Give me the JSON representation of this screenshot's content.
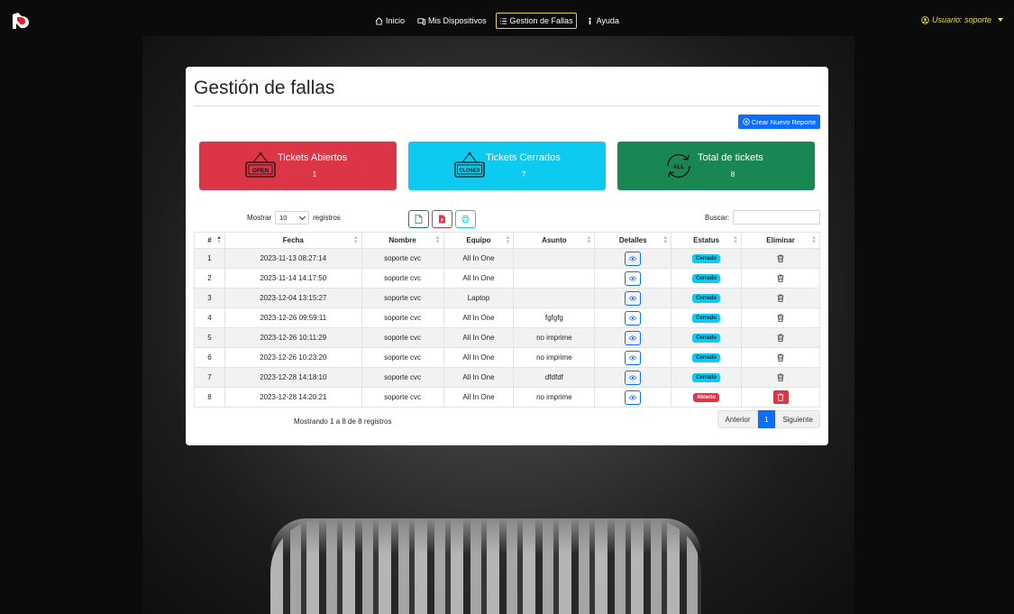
{
  "nav": {
    "links": [
      {
        "label": "Inicio",
        "icon": "home-icon"
      },
      {
        "label": "Mis Dispositivos",
        "icon": "devices-icon"
      },
      {
        "label": "Gestion de Fallas",
        "icon": "list-icon",
        "active": true
      },
      {
        "label": "Ayuda",
        "icon": "help-icon"
      }
    ],
    "user_label": "Usuario: soporte"
  },
  "page": {
    "title": "Gestión de fallas",
    "new_report_label": "Crear Nuevo Reporte"
  },
  "stats": [
    {
      "label": "Tickets Abiertos",
      "value": "1",
      "icon_text": "OPEN",
      "color": "#dc3545"
    },
    {
      "label": "Tickets Cerrados",
      "value": "7",
      "icon_text": "CLOSED",
      "color": "#0dcaf0"
    },
    {
      "label": "Total de tickets",
      "value": "8",
      "icon_text": "ALL",
      "color": "#198754"
    }
  ],
  "controls": {
    "show_label": "Mostrar",
    "show_value": "10",
    "records_label": "registros",
    "search_label": "Buscar:"
  },
  "table": {
    "headers": [
      "#",
      "Fecha",
      "Nombre",
      "Equipo",
      "Asunto",
      "Detalles",
      "Estatus",
      "Eliminar"
    ],
    "rows": [
      {
        "n": "1",
        "fecha": "2023-11-13 08:27:14",
        "nombre": "soporte cvc",
        "equipo": "All In One",
        "asunto": "",
        "estatus": "Cerrado"
      },
      {
        "n": "2",
        "fecha": "2023-11-14 14:17:50",
        "nombre": "soporte cvc",
        "equipo": "All In One",
        "asunto": "",
        "estatus": "Cerrado"
      },
      {
        "n": "3",
        "fecha": "2023-12-04 13:15:27",
        "nombre": "soporte cvc",
        "equipo": "Laptop",
        "asunto": "",
        "estatus": "Cerrado"
      },
      {
        "n": "4",
        "fecha": "2023-12-26 09:59:11",
        "nombre": "soporte cvc",
        "equipo": "All In One",
        "asunto": "fgfgfg",
        "estatus": "Cerrado"
      },
      {
        "n": "5",
        "fecha": "2023-12-26 10:11:29",
        "nombre": "soporte cvc",
        "equipo": "All In One",
        "asunto": "no imprime",
        "estatus": "Cerrado"
      },
      {
        "n": "6",
        "fecha": "2023-12-26 10:23:20",
        "nombre": "soporte cvc",
        "equipo": "All In One",
        "asunto": "no imprime",
        "estatus": "Cerrado"
      },
      {
        "n": "7",
        "fecha": "2023-12-28 14:18:10",
        "nombre": "soporte cvc",
        "equipo": "All In One",
        "asunto": "dfdfdf",
        "estatus": "Cerrado"
      },
      {
        "n": "8",
        "fecha": "2023-12-28 14:20:21",
        "nombre": "soporte cvc",
        "equipo": "All In One",
        "asunto": "no imprime",
        "estatus": "Abierto"
      }
    ]
  },
  "footer": {
    "info": "Mostrando 1 a 8 de 8 registros",
    "prev_label": "Anterior",
    "current_page": "1",
    "next_label": "Siguiente"
  }
}
